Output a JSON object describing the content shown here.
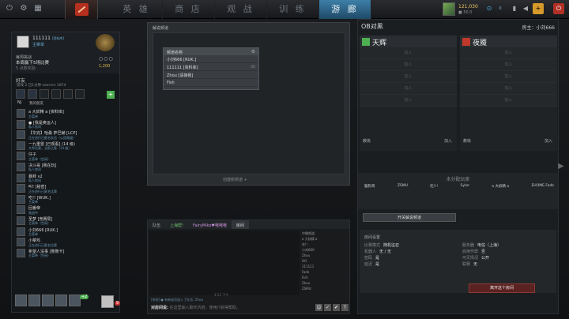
{
  "topbar": {
    "tabs": [
      "英 雄",
      "商 店",
      "观 战",
      "训 练",
      "游 廊"
    ],
    "active_tab_index": 4,
    "shards": "121,030",
    "shards_sub": "■ 50.0",
    "level": "0"
  },
  "profile": {
    "name": "111111",
    "tag": "[资料库]",
    "status": "主菜单",
    "medal_text": "5 3/8",
    "line1": "每周挑战",
    "line2": "本周赢下5场比赛",
    "line3": "5 点数奖励",
    "dots": "○○○",
    "gold": "1,200"
  },
  "friends": {
    "header": "好友",
    "subheader": "游戏 2   已1分钟   soerren   1874",
    "fav_label": "我的朋友",
    "fav_count": "Nj",
    "items": [
      {
        "name": "a 大妖精 a [资料库]",
        "status": "主菜单"
      },
      {
        "name": "● [我是奥运人]",
        "status": "私人房间"
      },
      {
        "name": "【华完】哈桑 萨巴赫 [LCP]",
        "status": "正在进行已匿名队伍（公用频道）"
      },
      {
        "name": "一九重雷 [已观看] (14 级)",
        "status": "大师比赛，当前之意（14 级）"
      },
      {
        "name": "仔子",
        "status": "主菜单（空闲）"
      },
      {
        "name": "决斗哥 [我在玩]",
        "status": "私人房间"
      },
      {
        "name": "暴拜 v2",
        "status": "私人房间"
      },
      {
        "name": "叫! [秘密]",
        "status": "正在进行已匿名比赛"
      },
      {
        "name": "吃!! [WUK.]",
        "status": "主菜单"
      },
      {
        "name": "回番帝",
        "status": "观战中"
      },
      {
        "name": "圣梦 [竞赛局]",
        "status": "主菜单（空闲）"
      },
      {
        "name": "小刘666 [RUK.]",
        "status": "主菜单"
      },
      {
        "name": "小菜鸡",
        "status": "正在进行已匿名比赛"
      },
      {
        "name": "希望人没事 [熊熊卡]",
        "status": "主菜单（空闲）"
      }
    ],
    "bottom_count": "+2",
    "my_notifications": "9"
  },
  "broadcast": {
    "title": "解说频道",
    "list_header": "频道名称",
    "rows": [
      {
        "name": "小刘666 [RUK.]",
        "note": ""
      },
      {
        "name": "111111 [资料库]",
        "note": "OK"
      },
      {
        "name": "Zhou [请接我]",
        "note": ""
      },
      {
        "name": "Fish",
        "note": ""
      }
    ],
    "create_label": "创建新频道 +"
  },
  "chat": {
    "tabs": [
      "队伍",
      "上海帮!",
      "FairyMiko♥哦哦哦",
      "房间"
    ],
    "members": [
      "中播频道",
      "a 大妖精 a",
      "吃!!",
      "小刘666",
      "Zhou",
      "OO",
      "111111",
      "Fade",
      "Fish",
      "Zhou",
      "ZSMU"
    ],
    "time": "4:52 下午",
    "system": "[系统] ● 有新成员加入了队伍: Zhou",
    "input_label": "对房间说:",
    "input_placeholder": "在这里输入聊天内容，使用/?获得帮助。"
  },
  "ob": {
    "title": "OB对黑",
    "host": "房主：小刘666",
    "radiant": "天辉",
    "dire": "夜魇",
    "join": "加入",
    "coach": "教练",
    "unassigned_title": "未分配玩家",
    "unassigned": [
      "鬣狗哥",
      "ZSMU",
      "吃!!!",
      "Sylar",
      "a 大妖精 a",
      "EHOME.Fade"
    ],
    "broadcast_button": "开关解说频道",
    "settings_title": "房间设置",
    "settings_left": [
      {
        "k": "比赛模式",
        "v": "随机征召"
      },
      {
        "k": "机器人",
        "v": "无 / 无"
      },
      {
        "k": "密码",
        "v": "是"
      },
      {
        "k": "延迟",
        "v": "是"
      }
    ],
    "settings_right": [
      {
        "k": "服务器",
        "v": "电信（上海）"
      },
      {
        "k": "启用作弊",
        "v": "否"
      },
      {
        "k": "可见情况",
        "v": "公开"
      },
      {
        "k": "联赛",
        "v": "无"
      }
    ],
    "leave_button": "离开这个房间"
  },
  "colors": {
    "active_tab": "#3e7fa8",
    "radiant": "#4caf50",
    "dire": "#c0392b",
    "leave": "#5a2220"
  }
}
